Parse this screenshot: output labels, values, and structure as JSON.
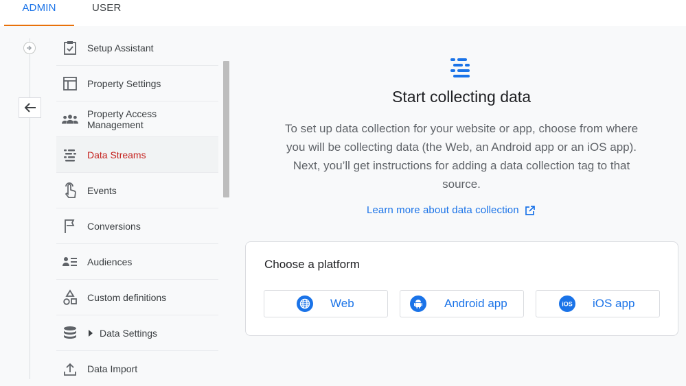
{
  "tabs": {
    "admin": "ADMIN",
    "user": "USER"
  },
  "nav": {
    "items": [
      {
        "label": "Setup Assistant"
      },
      {
        "label": "Property Settings"
      },
      {
        "label": "Property Access\nManagement"
      },
      {
        "label": "Data Streams"
      },
      {
        "label": "Events"
      },
      {
        "label": "Conversions"
      },
      {
        "label": "Audiences"
      },
      {
        "label": "Custom definitions"
      },
      {
        "label": "Data Settings"
      },
      {
        "label": "Data Import"
      }
    ]
  },
  "main": {
    "title": "Start collecting data",
    "description": "To set up data collection for your website or app, choose from where you will be collecting data (the Web, an Android app or an iOS app). Next, you’ll get instructions for adding a data collection tag to that source.",
    "learn_more": "Learn more about data collection",
    "card": {
      "title": "Choose a platform",
      "buttons": {
        "web": "Web",
        "android": "Android app",
        "ios": "iOS app"
      },
      "ios_icon_text": "iOS"
    }
  },
  "colors": {
    "accent": "#1a73e8",
    "active": "#c5221f",
    "tab_underline": "#e8710a"
  }
}
